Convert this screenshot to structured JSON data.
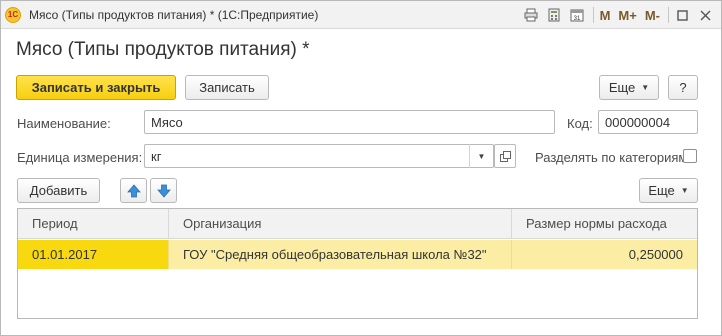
{
  "window": {
    "title": "Мясо (Типы продуктов питания) * (1С:Предприятие)",
    "logo_text": "1С",
    "toolbar_icons": [
      "printer-icon",
      "calculator-icon",
      "calendar-icon"
    ],
    "memory_buttons": [
      "M",
      "M+",
      "M-"
    ],
    "calendar_day": "31"
  },
  "form": {
    "title": "Мясо (Типы продуктов питания) *",
    "buttons": {
      "save_close": "Записать и закрыть",
      "save": "Записать",
      "more": "Еще",
      "help": "?"
    },
    "fields": {
      "name_label": "Наименование:",
      "name_value": "Мясо",
      "code_label": "Код:",
      "code_value": "000000004",
      "unit_label": "Единица измерения:",
      "unit_value": "кг",
      "split_label": "Разделять по категориям:",
      "split_checked": false
    }
  },
  "table": {
    "toolbar": {
      "add": "Добавить",
      "more": "Еще"
    },
    "columns": [
      "Период",
      "Организация",
      "Размер нормы расхода"
    ],
    "rows": [
      {
        "period": "01.01.2017",
        "org": "ГОУ \"Средняя общеобразовательная школа №32\"",
        "norm": "0,250000"
      }
    ]
  }
}
